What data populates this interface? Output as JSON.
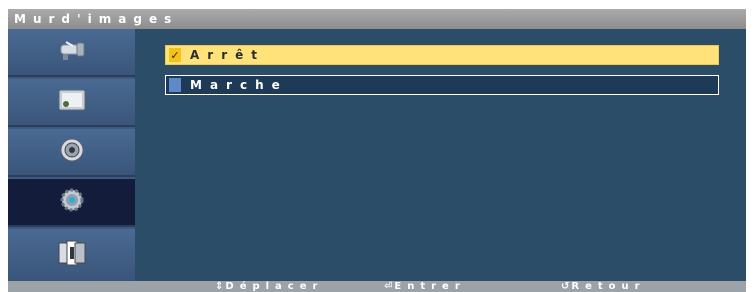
{
  "title": "Murd'images",
  "sidebar": {
    "items": [
      {
        "icon": "satellite-dish-icon",
        "active": false
      },
      {
        "icon": "picture-icon",
        "active": false
      },
      {
        "icon": "speaker-icon",
        "active": false
      },
      {
        "icon": "gear-icon",
        "active": true
      },
      {
        "icon": "video-wall-icon",
        "active": false
      }
    ]
  },
  "options": [
    {
      "label": "Arrêt",
      "checked": true
    },
    {
      "label": "Marche",
      "checked": false
    }
  ],
  "footer": {
    "move_icon": "⇕",
    "move_label": "Déplacer",
    "enter_icon": "⏎",
    "enter_label": "Entrer",
    "back_icon": "↺",
    "back_label": "Retour"
  },
  "colors": {
    "selected_bg": "#ffe27a",
    "content_bg": "#2c4d68",
    "sidebar_bg": "#3f5a80",
    "sidebar_active": "#141c3c"
  }
}
